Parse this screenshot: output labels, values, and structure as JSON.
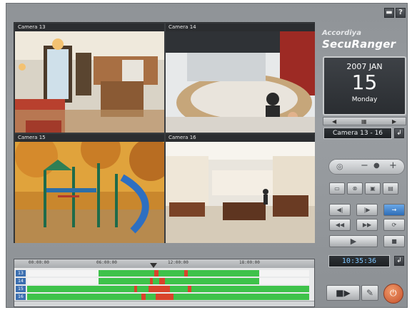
{
  "window": {
    "minimize_icon": "minimize-icon",
    "help_label": "?"
  },
  "cameras": [
    {
      "label": "Camera 13",
      "scene": "living-room"
    },
    {
      "label": "Camera 14",
      "scene": "reception-desk"
    },
    {
      "label": "Camera 15",
      "scene": "playground"
    },
    {
      "label": "Camera 16",
      "scene": "retail-store"
    }
  ],
  "brand": {
    "line1": "Accordiya",
    "line2": "SecuRanger"
  },
  "calendar": {
    "year_month": "2007  JAN",
    "day": "15",
    "weekday": "Monday"
  },
  "camera_group": "Camera 13 - 16",
  "time_display": "10:35:36",
  "timeline": {
    "ticks": [
      "00:00:00",
      "06:00:00",
      "12:00:00",
      "18:00:00"
    ],
    "rows": [
      "13",
      "14",
      "15",
      "16"
    ],
    "colors": {
      "recorded": "#3ec24a",
      "event": "#d9432b"
    }
  },
  "colors": {
    "panel": "#9a9ea2",
    "accent_blue": "#3c6fb0"
  }
}
